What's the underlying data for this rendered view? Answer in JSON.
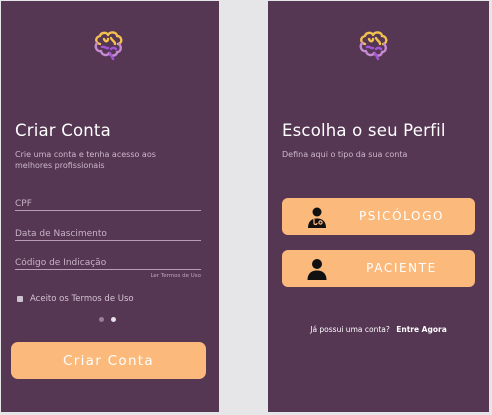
{
  "colors": {
    "screen_background": "#553653",
    "accent": "#fcb97c",
    "text": "#ffffff",
    "muted_text": "#cdb7cb",
    "logo_yellow": "#f2c14e",
    "logo_purple": "#a455d6"
  },
  "signup": {
    "logo_icon": "brain-icon",
    "title": "Criar Conta",
    "subtitle": "Crie uma conta e tenha acesso aos melhores profissionais",
    "fields": {
      "cpf_placeholder": "CPF",
      "nascimento_placeholder": "Data de Nascimento",
      "indicacao_placeholder": "Código de Indicação"
    },
    "terms_link": "Ler Termos de Uso",
    "accept_terms": "Aceito os Termos de Uso",
    "accept_checked": false,
    "pager": {
      "count": 2,
      "active_index": 1
    },
    "submit_label": "Criar Conta"
  },
  "profile": {
    "logo_icon": "brain-icon",
    "title": "Escolha o seu Perfil",
    "subtitle": "Defina aqui o tipo da sua conta",
    "psicologo": {
      "icon": "doctor-icon",
      "label": "PSICÓLOGO"
    },
    "paciente": {
      "icon": "user-icon",
      "label": "PACIENTE"
    },
    "have_account": "Já possui uma conta?",
    "login_link": "Entre Agora"
  }
}
